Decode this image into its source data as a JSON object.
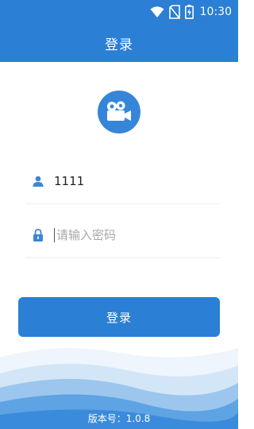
{
  "status_bar": {
    "time": "10:30",
    "icons": [
      "wifi-icon",
      "no-sim-icon",
      "battery-charging-icon"
    ]
  },
  "app_bar": {
    "title": "登录"
  },
  "logo": {
    "icon": "video-camera-icon"
  },
  "form": {
    "username": {
      "icon": "user-icon",
      "value": "1111"
    },
    "password": {
      "icon": "lock-icon",
      "placeholder": "请输入密码",
      "value": ""
    },
    "login_label": "登录"
  },
  "footer": {
    "version": "版本号：1.0.8"
  },
  "colors": {
    "primary": "#2b7fd4",
    "logo": "#3586d8",
    "wave_light": "#e6f1fb"
  }
}
